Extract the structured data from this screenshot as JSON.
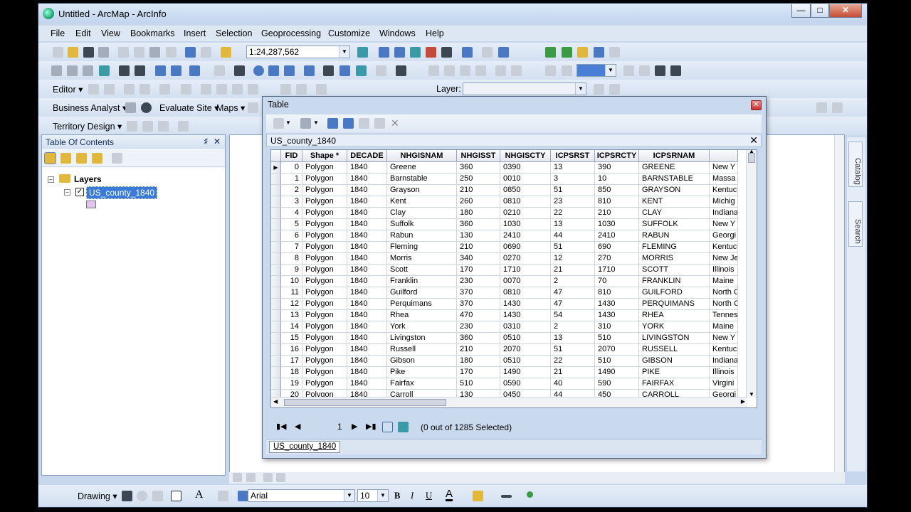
{
  "window": {
    "title": "Untitled - ArcMap - ArcInfo"
  },
  "menu": [
    "File",
    "Edit",
    "View",
    "Bookmarks",
    "Insert",
    "Selection",
    "Geoprocessing",
    "Customize",
    "Windows",
    "Help"
  ],
  "toolbar": {
    "scale": "1:24,287,562",
    "editor_label": "Editor",
    "layer_label": "Layer:",
    "business_analyst_label": "Business Analyst",
    "evaluate_site_label": "Evaluate Site",
    "maps_label": "Maps",
    "territory_design_label": "Territory Design"
  },
  "toc": {
    "title": "Table Of Contents",
    "root": "Layers",
    "layer_name": "US_county_1840",
    "layer_color": "#e3c6f0"
  },
  "side_tabs": [
    "Catalog",
    "Search"
  ],
  "table_window": {
    "title": "Table",
    "tab_header": "US_county_1840",
    "footer_tab": "US_county_1840",
    "record_position": "1",
    "selection_status": "(0 out of 1285 Selected)"
  },
  "columns": [
    "FID",
    "Shape *",
    "DECADE",
    "NHGISNAM",
    "NHGISST",
    "NHGISCTY",
    "ICPSRST",
    "ICPSRCTY",
    "ICPSRNAM",
    ""
  ],
  "rows": [
    [
      "0",
      "Polygon",
      "1840",
      "Greene",
      "360",
      "0390",
      "13",
      "390",
      "GREENE",
      "New Y"
    ],
    [
      "1",
      "Polygon",
      "1840",
      "Barnstable",
      "250",
      "0010",
      "3",
      "10",
      "BARNSTABLE",
      "Massa"
    ],
    [
      "2",
      "Polygon",
      "1840",
      "Grayson",
      "210",
      "0850",
      "51",
      "850",
      "GRAYSON",
      "Kentuc"
    ],
    [
      "3",
      "Polygon",
      "1840",
      "Kent",
      "260",
      "0810",
      "23",
      "810",
      "KENT",
      "Michig"
    ],
    [
      "4",
      "Polygon",
      "1840",
      "Clay",
      "180",
      "0210",
      "22",
      "210",
      "CLAY",
      "Indiana"
    ],
    [
      "5",
      "Polygon",
      "1840",
      "Suffolk",
      "360",
      "1030",
      "13",
      "1030",
      "SUFFOLK",
      "New Y"
    ],
    [
      "6",
      "Polygon",
      "1840",
      "Rabun",
      "130",
      "2410",
      "44",
      "2410",
      "RABUN",
      "Georgi"
    ],
    [
      "7",
      "Polygon",
      "1840",
      "Fleming",
      "210",
      "0690",
      "51",
      "690",
      "FLEMING",
      "Kentuc"
    ],
    [
      "8",
      "Polygon",
      "1840",
      "Morris",
      "340",
      "0270",
      "12",
      "270",
      "MORRIS",
      "New Je"
    ],
    [
      "9",
      "Polygon",
      "1840",
      "Scott",
      "170",
      "1710",
      "21",
      "1710",
      "SCOTT",
      "Illinois"
    ],
    [
      "10",
      "Polygon",
      "1840",
      "Franklin",
      "230",
      "0070",
      "2",
      "70",
      "FRANKLIN",
      "Maine"
    ],
    [
      "11",
      "Polygon",
      "1840",
      "Guilford",
      "370",
      "0810",
      "47",
      "810",
      "GUILFORD",
      "North C"
    ],
    [
      "12",
      "Polygon",
      "1840",
      "Perquimans",
      "370",
      "1430",
      "47",
      "1430",
      "PERQUIMANS",
      "North C"
    ],
    [
      "13",
      "Polygon",
      "1840",
      "Rhea",
      "470",
      "1430",
      "54",
      "1430",
      "RHEA",
      "Tennes"
    ],
    [
      "14",
      "Polygon",
      "1840",
      "York",
      "230",
      "0310",
      "2",
      "310",
      "YORK",
      "Maine"
    ],
    [
      "15",
      "Polygon",
      "1840",
      "Livingston",
      "360",
      "0510",
      "13",
      "510",
      "LIVINGSTON",
      "New Y"
    ],
    [
      "16",
      "Polygon",
      "1840",
      "Russell",
      "210",
      "2070",
      "51",
      "2070",
      "RUSSELL",
      "Kentuc"
    ],
    [
      "17",
      "Polygon",
      "1840",
      "Gibson",
      "180",
      "0510",
      "22",
      "510",
      "GIBSON",
      "Indiana"
    ],
    [
      "18",
      "Polygon",
      "1840",
      "Pike",
      "170",
      "1490",
      "21",
      "1490",
      "PIKE",
      "Illinois"
    ],
    [
      "19",
      "Polygon",
      "1840",
      "Fairfax",
      "510",
      "0590",
      "40",
      "590",
      "FAIRFAX",
      "Virgini"
    ],
    [
      "20",
      "Polygon",
      "1840",
      "Carroll",
      "130",
      "0450",
      "44",
      "450",
      "CARROLL",
      "Georgi"
    ]
  ],
  "drawing": {
    "label": "Drawing",
    "font": "Arial",
    "size": "10"
  }
}
